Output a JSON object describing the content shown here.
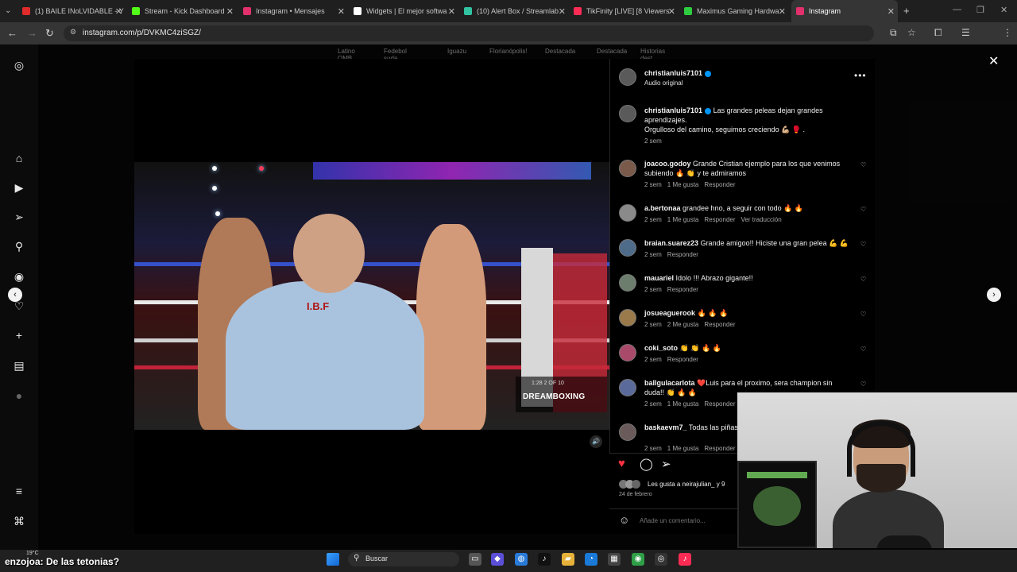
{
  "browser": {
    "tabs": [
      {
        "title": "(1) BAILE INoLVIDABLE - Y",
        "color": "#e02b2b"
      },
      {
        "title": "Stream - Kick Dashboard",
        "color": "#53fc18"
      },
      {
        "title": "Instagram • Mensajes",
        "color": "#e1306c"
      },
      {
        "title": "Widgets | El mejor softwa",
        "color": "#ffffff"
      },
      {
        "title": "(10) Alert Box / Streamlab",
        "color": "#31c3a2"
      },
      {
        "title": "TikFinity [LIVE] [8 Viewers",
        "color": "#fe2c55"
      },
      {
        "title": "Maximus Gaming Hardwa",
        "color": "#2ecc40"
      },
      {
        "title": "Instagram",
        "color": "#e1306c"
      }
    ],
    "new_tab": "+",
    "url": "instagram.com/p/DVKMC4ziSGZ/"
  },
  "stories": [
    "Latino OMB",
    "Fedebol suda...",
    "Iguazu",
    "Florianópolis!",
    "Destacada",
    "Destacada",
    "Historias dest..."
  ],
  "post": {
    "author": "christianluis7101",
    "audio": "Audio original",
    "caption_line1": "Las grandes peleas dejan grandes",
    "caption_line2": "aprendizajes.",
    "caption_line3": "Orgulloso del camino, seguimos creciendo 💪🏼 🥊 .",
    "caption_time": "2 sem",
    "video_overlay": {
      "ibf": "I.B.F",
      "timer": "1:28     2 OF 10",
      "brand": "DREAMBOXING"
    },
    "likes_text": "Les gusta a neirajulian_ y 9",
    "date": "24 de febrero",
    "comment_placeholder": "Añade un comentario..."
  },
  "comments": [
    {
      "user": "joacoo.godoy",
      "text": "Grande Cristian ejemplo para los que venimos subiendo 🔥 👏 y te admiramos",
      "time": "2 sem",
      "likes": "1 Me gusta",
      "reply": "Responder",
      "extra": ""
    },
    {
      "user": "a.bertonaa",
      "text": "grandee hno, a seguir con todo 🔥 🔥",
      "time": "2 sem",
      "likes": "1 Me gusta",
      "reply": "Responder",
      "extra": "Ver traducción"
    },
    {
      "user": "braian.suarez23",
      "text": "Grande amigoo!! Hiciste una gran pelea 💪 💪",
      "time": "2 sem",
      "likes": "",
      "reply": "Responder",
      "extra": ""
    },
    {
      "user": "mauariel",
      "text": "Idolo !!! Abrazo gigante!!",
      "time": "2 sem",
      "likes": "",
      "reply": "Responder",
      "extra": ""
    },
    {
      "user": "josueaguerook",
      "text": "🔥 🔥 🔥",
      "time": "2 sem",
      "likes": "2 Me gusta",
      "reply": "Responder",
      "extra": ""
    },
    {
      "user": "coki_soto",
      "text": "👏 👏 🔥 🔥",
      "time": "2 sem",
      "likes": "",
      "reply": "Responder",
      "extra": ""
    },
    {
      "user": "ballgulacarlota",
      "text": "❤️Luis para el proximo, sera champion sin duda!! 👏 🔥 🔥",
      "time": "2 sem",
      "likes": "1 Me gusta",
      "reply": "Responder",
      "extra": ""
    },
    {
      "user": "baskaevm7_",
      "text": "Todas las piñas un peleón",
      "time": "2 sem",
      "likes": "1 Me gusta",
      "reply": "Responder",
      "extra": ""
    }
  ],
  "taskbar": {
    "weather": "19°C",
    "caption_user": "enzojoa:",
    "caption_text": "De las tetonias?",
    "search": "Buscar"
  },
  "colors": {
    "like_red": "#ff3040",
    "verified": "#0095f6",
    "panel_bg": "#000000",
    "muted": "#a8a8a8"
  }
}
